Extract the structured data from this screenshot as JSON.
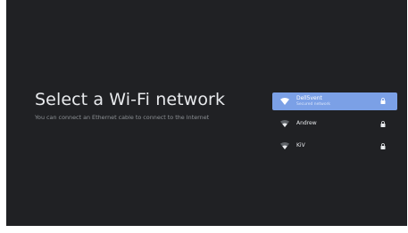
{
  "page": {
    "title": "Select a Wi-Fi network",
    "subtitle": "You can connect an Ethernet cable to connect to the Internet"
  },
  "networks": [
    {
      "name": "Dell5vent",
      "status": "Secured network",
      "signal_icon": "wifi-icon",
      "secure_icon": "lock-icon",
      "focused": true
    },
    {
      "name": "Andrew",
      "status": "",
      "signal_icon": "wifi-icon",
      "secure_icon": "lock-icon",
      "focused": false
    },
    {
      "name": "KiV",
      "status": "",
      "signal_icon": "wifi-icon",
      "secure_icon": "lock-icon",
      "focused": false
    }
  ],
  "colors": {
    "background": "#202124",
    "focus": "#7ba0e6",
    "text": "#e8eaed",
    "muted": "#8d9195"
  }
}
